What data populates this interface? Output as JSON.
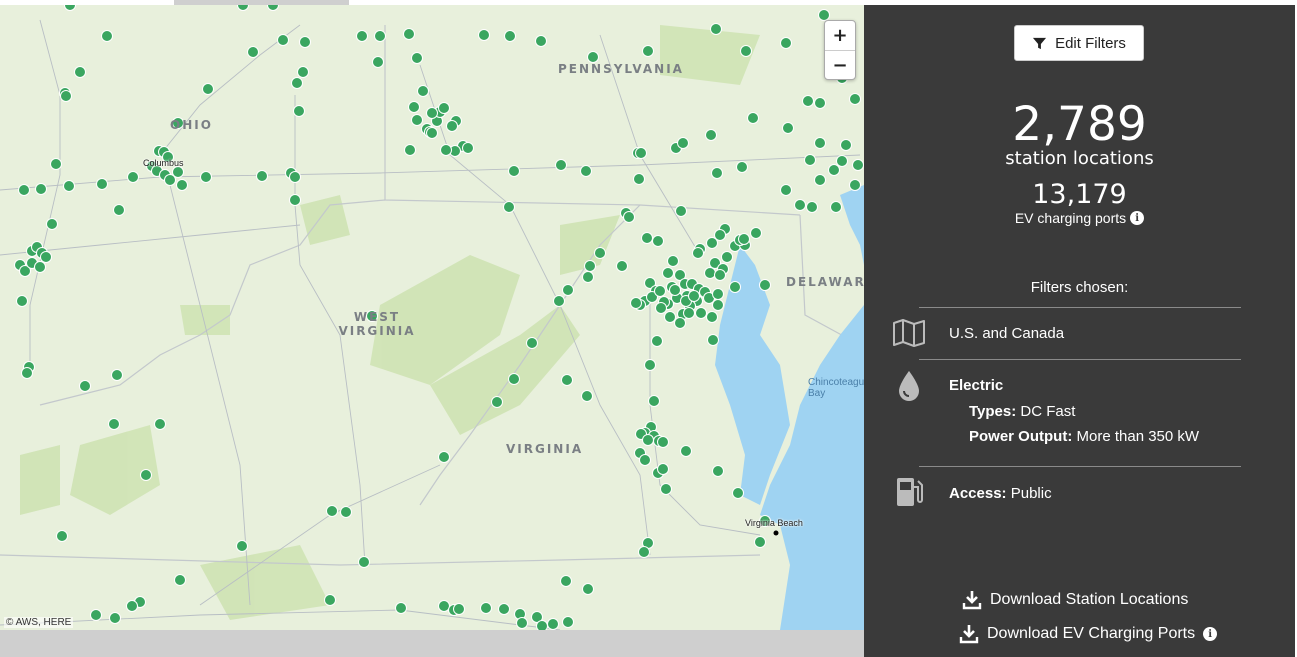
{
  "map": {
    "zoom_in_label": "+",
    "zoom_out_label": "−",
    "attribution": "© AWS, HERE",
    "state_labels": [
      "OHIO",
      "PENNSYLVANIA",
      "WEST\nVIRGINIA",
      "VIRGINIA",
      "DELAWAR"
    ],
    "city_labels": [
      "Columbus",
      "Virginia Beach"
    ],
    "water_labels": [
      "Chincoteague\nBay"
    ],
    "marker_color": "#3aa660",
    "water_color": "#9fd3f2",
    "land_color": "#e8f0dc"
  },
  "panel": {
    "edit_filters_label": "Edit Filters",
    "station_count": "2,789",
    "station_label": "station locations",
    "port_count": "13,179",
    "port_label": "EV charging ports",
    "filters_title": "Filters chosen:",
    "region": "U.S. and Canada",
    "fuel": {
      "name": "Electric",
      "types_label": "Types:",
      "types_value": "DC Fast",
      "power_label": "Power Output:",
      "power_value": "More than 350 kW"
    },
    "access_label": "Access:",
    "access_value": "Public",
    "download_stations": "Download Station Locations",
    "download_ports": "Download EV Charging Ports",
    "background_color": "#3a3a3a"
  }
}
